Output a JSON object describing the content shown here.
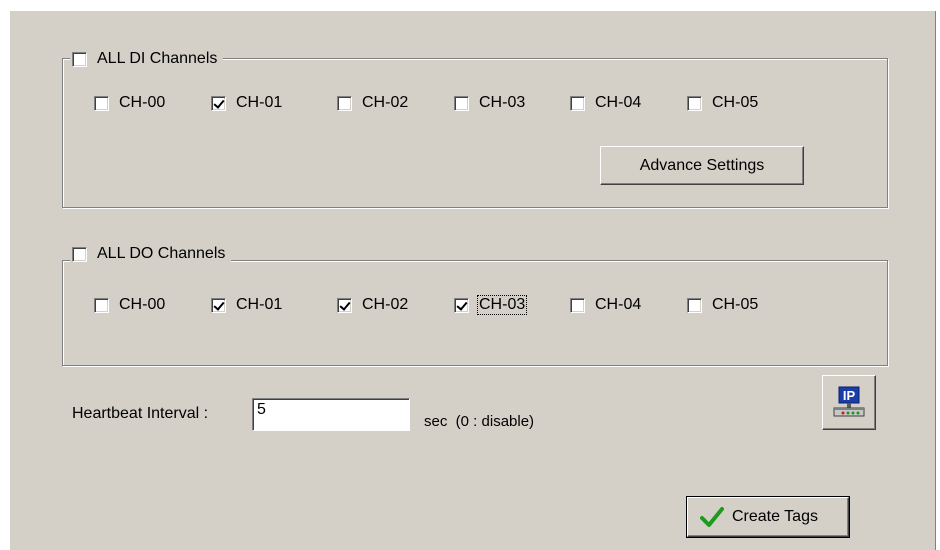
{
  "di_group": {
    "all_label": "ALL DI Channels",
    "all_checked": false,
    "channels": [
      {
        "label": "CH-00",
        "checked": false
      },
      {
        "label": "CH-01",
        "checked": true
      },
      {
        "label": "CH-02",
        "checked": false
      },
      {
        "label": "CH-03",
        "checked": false
      },
      {
        "label": "CH-04",
        "checked": false
      },
      {
        "label": "CH-05",
        "checked": false
      }
    ],
    "advance_button": "Advance Settings"
  },
  "do_group": {
    "all_label": "ALL DO Channels",
    "all_checked": false,
    "channels": [
      {
        "label": "CH-00",
        "checked": false
      },
      {
        "label": "CH-01",
        "checked": true
      },
      {
        "label": "CH-02",
        "checked": true
      },
      {
        "label": "CH-03",
        "checked": true
      },
      {
        "label": "CH-04",
        "checked": false
      },
      {
        "label": "CH-05",
        "checked": false
      }
    ]
  },
  "heartbeat": {
    "label": "Heartbeat Interval :",
    "value": "5",
    "unit_hint": "sec  (0 : disable)"
  },
  "ip_button_icon": "ip-network-icon",
  "create_tags_button": {
    "label": "Create Tags",
    "icon": "checkmark-icon",
    "icon_color": "#1e9a1e"
  }
}
